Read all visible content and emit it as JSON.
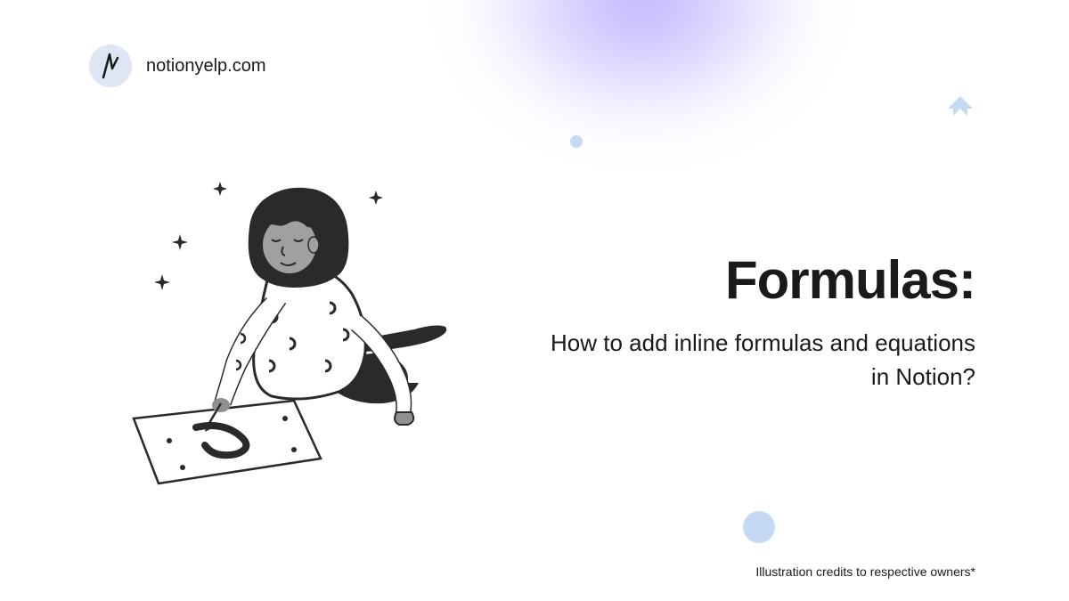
{
  "header": {
    "brand": "notionyelp.com"
  },
  "content": {
    "title": "Formulas:",
    "subtitle": "How to add inline formulas and equations in Notion?"
  },
  "footer": {
    "credits": "Illustration credits to respective owners*"
  }
}
